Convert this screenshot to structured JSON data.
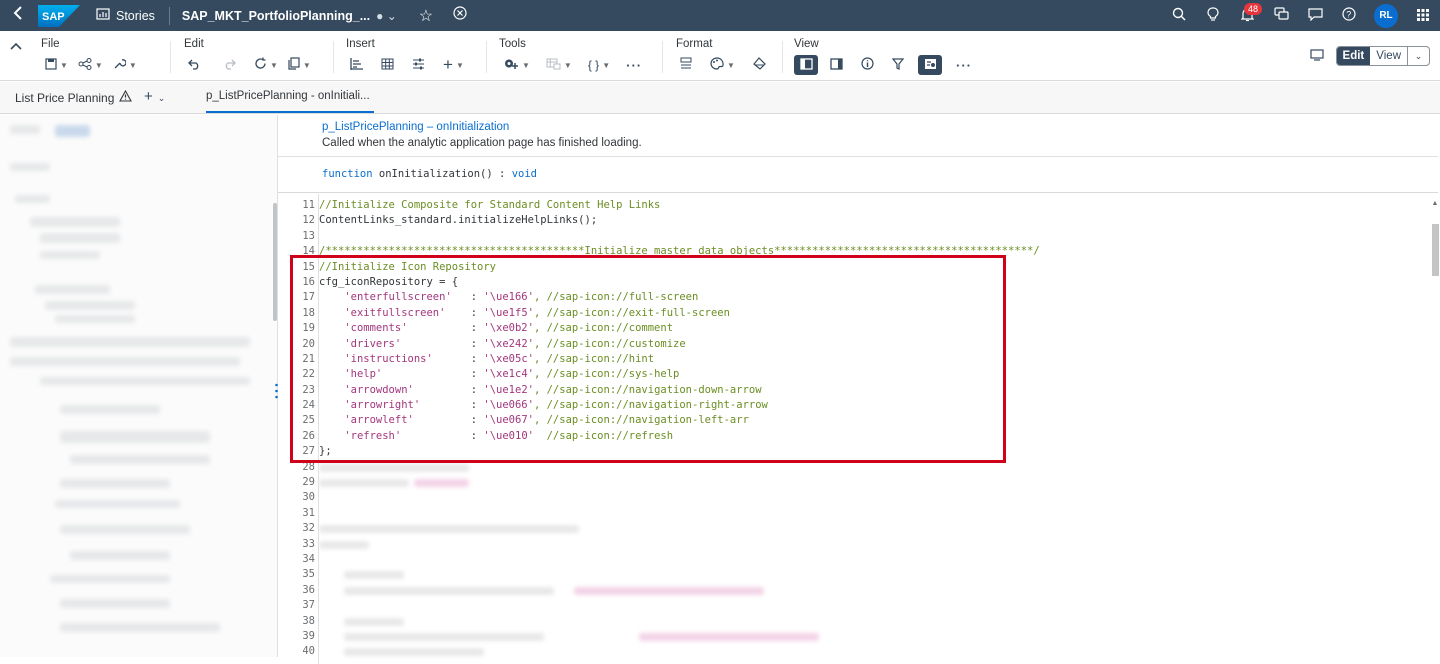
{
  "shell": {
    "logo": "SAP",
    "stories_label": "Stories",
    "title": "SAP_MKT_PortfolioPlanning_...",
    "notification_count": "48",
    "avatar_initials": "RL"
  },
  "toolbar": {
    "groups": {
      "file": "File",
      "edit": "Edit",
      "insert": "Insert",
      "tools": "Tools",
      "format": "Format",
      "view": "View"
    },
    "tools_braces": "{ }",
    "edit_mode": "Edit",
    "view_mode": "View"
  },
  "tabs": {
    "page_tab": "List Price Planning",
    "script_tab": "p_ListPricePlanning - onInitiali..."
  },
  "editor": {
    "event_link": "p_ListPricePlanning – onInitialization",
    "event_description": "Called when the analytic application page has finished loading.",
    "signature": {
      "keyword": "function",
      "name": "onInitialization()",
      "rest": ":",
      "return_type": "void"
    },
    "lines": [
      {
        "n": "11",
        "text": "//Initialize Composite for Standard Content Help Links",
        "kind": "comment"
      },
      {
        "n": "12",
        "text": "ContentLinks_standard.initializeHelpLinks();",
        "kind": "code"
      },
      {
        "n": "13",
        "text": "",
        "kind": "code"
      },
      {
        "n": "14",
        "text": "/*****************************************Initialize master data objects*****************************************/",
        "kind": "comment"
      },
      {
        "n": "15",
        "text": "//Initialize Icon Repository",
        "kind": "comment"
      },
      {
        "n": "16",
        "text": "cfg_iconRepository = {",
        "kind": "code"
      },
      {
        "n": "17",
        "key": "'enterfullscreen'",
        "pad": "   ",
        "val": "'\\ue166'",
        "cmt": ", //sap-icon://full-screen",
        "kind": "entry"
      },
      {
        "n": "18",
        "key": "'exitfullscreen'",
        "pad": "    ",
        "val": "'\\ue1f5'",
        "cmt": ", //sap-icon://exit-full-screen",
        "kind": "entry"
      },
      {
        "n": "19",
        "key": "'comments'",
        "pad": "          ",
        "val": "'\\xe0b2'",
        "cmt": ", //sap-icon://comment",
        "kind": "entry"
      },
      {
        "n": "20",
        "key": "'drivers'",
        "pad": "           ",
        "val": "'\\xe242'",
        "cmt": ", //sap-icon://customize",
        "kind": "entry"
      },
      {
        "n": "21",
        "key": "'instructions'",
        "pad": "      ",
        "val": "'\\xe05c'",
        "cmt": ", //sap-icon://hint",
        "kind": "entry"
      },
      {
        "n": "22",
        "key": "'help'",
        "pad": "              ",
        "val": "'\\xe1c4'",
        "cmt": ", //sap-icon://sys-help",
        "kind": "entry"
      },
      {
        "n": "23",
        "key": "'arrowdown'",
        "pad": "         ",
        "val": "'\\ue1e2'",
        "cmt": ", //sap-icon://navigation-down-arrow",
        "kind": "entry"
      },
      {
        "n": "24",
        "key": "'arrowright'",
        "pad": "        ",
        "val": "'\\ue066'",
        "cmt": ", //sap-icon://navigation-right-arrow",
        "kind": "entry"
      },
      {
        "n": "25",
        "key": "'arrowleft'",
        "pad": "         ",
        "val": "'\\ue067'",
        "cmt": ", //sap-icon://navigation-left-arr",
        "kind": "entry"
      },
      {
        "n": "26",
        "key": "'refresh'",
        "pad": "           ",
        "val": "'\\ue010'",
        "cmt": "  //sap-icon://refresh",
        "kind": "entry"
      },
      {
        "n": "27",
        "text": "};",
        "kind": "code"
      },
      {
        "n": "28",
        "text": "",
        "kind": "blur"
      },
      {
        "n": "29",
        "text": "",
        "kind": "blur"
      },
      {
        "n": "30",
        "text": "",
        "kind": "blur"
      },
      {
        "n": "31",
        "text": "",
        "kind": "blur"
      },
      {
        "n": "32",
        "text": "",
        "kind": "blur"
      },
      {
        "n": "33",
        "text": "",
        "kind": "blur"
      },
      {
        "n": "34",
        "text": "",
        "kind": "blur"
      },
      {
        "n": "35",
        "text": "",
        "kind": "blur"
      },
      {
        "n": "36",
        "text": "",
        "kind": "blur"
      },
      {
        "n": "37",
        "text": "",
        "kind": "blur"
      },
      {
        "n": "38",
        "text": "",
        "kind": "blur"
      },
      {
        "n": "39",
        "text": "",
        "kind": "blur"
      },
      {
        "n": "40",
        "text": "",
        "kind": "blur"
      }
    ]
  },
  "colors": {
    "shell_bg": "#354a5f",
    "accent": "#0a6ed1",
    "comment": "#6b8e23",
    "string": "#a3367d",
    "highlight_box": "#d0021b",
    "badge": "#e5363e"
  }
}
